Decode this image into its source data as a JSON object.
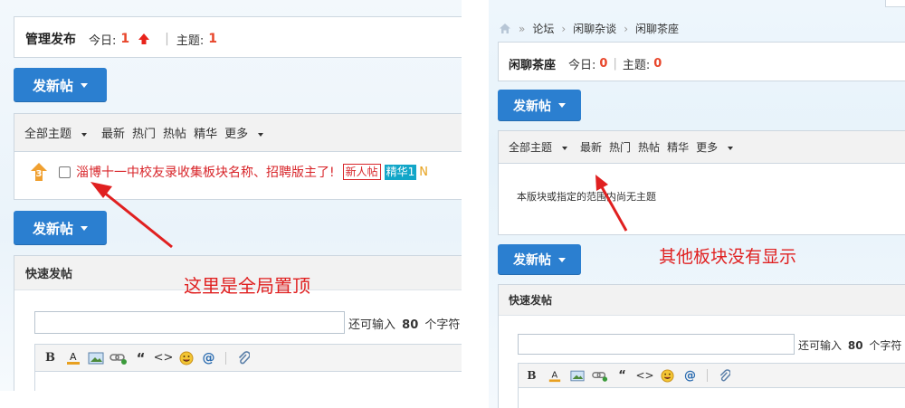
{
  "left": {
    "header": {
      "title": "管理发布",
      "today_label": "今日:",
      "today_value": "1",
      "topics_label": "主题:",
      "topics_value": "1"
    },
    "post_button_top": "发新帖",
    "filters": {
      "all": "全部主题",
      "latest": "最新",
      "hot": "热门",
      "hot_posts": "热帖",
      "digest": "精华",
      "more": "更多"
    },
    "thread": {
      "pin_level": "3",
      "title": "淄博十一中校友录收集板块名称、招聘版主了!",
      "badge_new": "新人帖",
      "badge_digest": "精华1",
      "trailing": "N"
    },
    "post_button_bottom": "发新帖",
    "quick_post": {
      "header": "快速发帖",
      "remaining_prefix": "还可输入",
      "remaining_count": "80",
      "remaining_suffix": "个字符"
    }
  },
  "right": {
    "breadcrumb": {
      "sep": "»",
      "items": [
        "论坛",
        "闲聊杂谈",
        "闲聊茶座"
      ],
      "arrow": "›"
    },
    "header": {
      "title": "闲聊茶座",
      "today_label": "今日:",
      "today_value": "0",
      "topics_label": "主题:",
      "topics_value": "0"
    },
    "post_button_top": "发新帖",
    "filters": {
      "all": "全部主题",
      "latest": "最新",
      "hot": "热门",
      "hot_posts": "热帖",
      "digest": "精华",
      "more": "更多"
    },
    "empty_text": "本版块或指定的范围内尚无主题",
    "post_button_bottom": "发新帖",
    "quick_post": {
      "header": "快速发帖",
      "remaining_prefix": "还可输入",
      "remaining_count": "80",
      "remaining_suffix": "个字符"
    }
  },
  "annotations": {
    "left": "这里是全局置顶",
    "right": "其他板块没有显示"
  },
  "colors": {
    "button": "#2b7fd0",
    "accent_red": "#e8462b",
    "annotation": "#e02020",
    "digest_badge": "#12a6c8"
  },
  "toolbar_icons": [
    "bold-icon",
    "font-color-icon",
    "image-icon",
    "link-icon",
    "quote-icon",
    "code-icon",
    "smiley-icon",
    "mention-icon",
    "attachment-icon"
  ]
}
